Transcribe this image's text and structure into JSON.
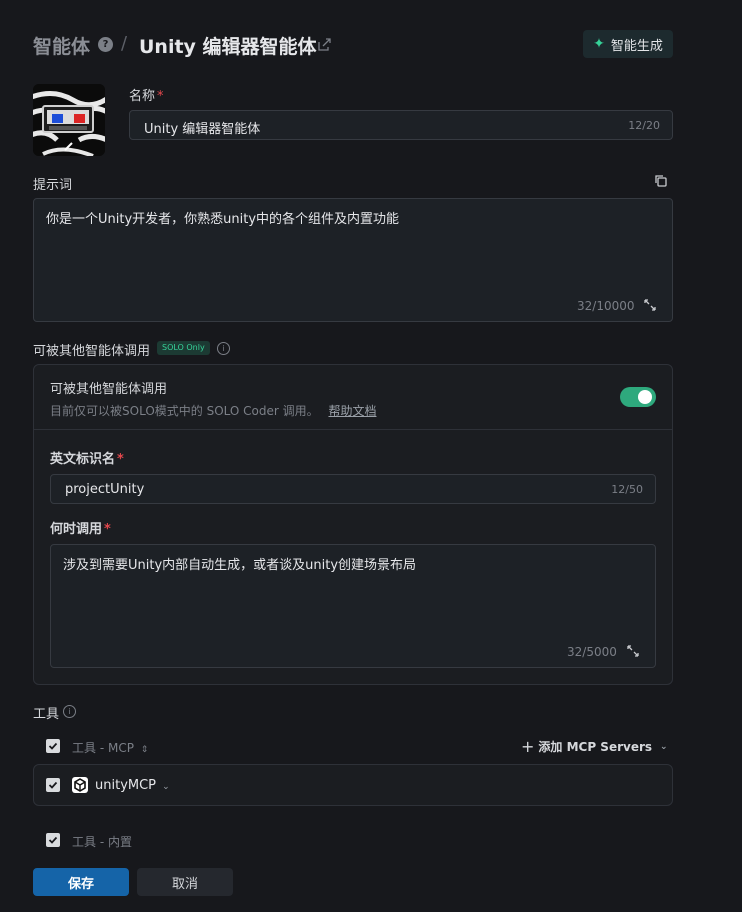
{
  "header": {
    "breadcrumb_root": "智能体",
    "help_glyph": "?",
    "separator": "/",
    "title": "Unity 编辑器智能体",
    "ai_generate_label": "智能生成"
  },
  "name_field": {
    "label": "名称",
    "required_mark": "*",
    "value": "Unity 编辑器智能体",
    "counter": "12/20"
  },
  "prompt_field": {
    "label": "提示词",
    "value": "你是一个Unity开发者，你熟悉unity中的各个组件及内置功能",
    "counter": "32/10000"
  },
  "callable_section": {
    "label": "可被其他智能体调用",
    "badge": "SOLO Only",
    "info_glyph": "i",
    "card_title": "可被其他智能体调用",
    "card_desc": "目前仅可以被SOLO模式中的 SOLO Coder 调用。",
    "help_link": "帮助文档",
    "toggle_on": true,
    "english_id": {
      "label": "英文标识名",
      "required_mark": "*",
      "value": "projectUnity",
      "counter": "12/50"
    },
    "when_to_call": {
      "label": "何时调用",
      "required_mark": "*",
      "value": "涉及到需要Unity内部自动生成，或者谈及unity创建场景布局",
      "counter": "32/5000"
    }
  },
  "tools_section": {
    "label": "工具",
    "info_glyph": "i",
    "mcp_group_label": "工具 - MCP",
    "add_mcp_label": "添加 MCP Servers",
    "mcp_items": [
      {
        "name": "unityMCP",
        "checked": true
      }
    ],
    "builtin_group_label": "工具 - 内置"
  },
  "footer": {
    "save_label": "保存",
    "cancel_label": "取消"
  },
  "colors": {
    "background": "#17181c",
    "accent_green": "#2ea97d",
    "primary_blue": "#1564a8",
    "required_red": "#e5484d"
  }
}
